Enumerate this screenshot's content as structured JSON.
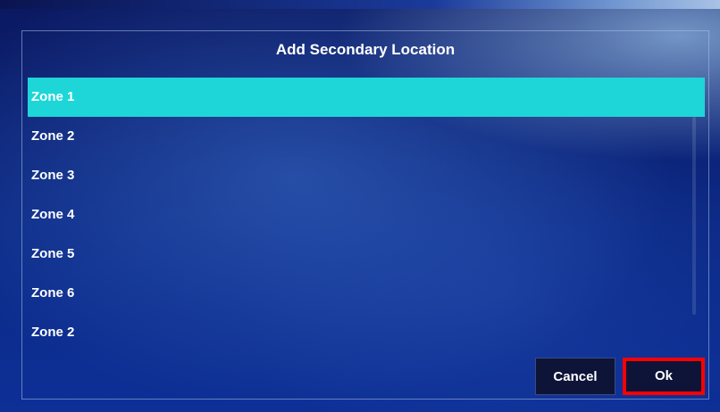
{
  "dialog": {
    "title": "Add Secondary Location",
    "items": [
      {
        "label": "Zone 1",
        "selected": true
      },
      {
        "label": "Zone 2",
        "selected": false
      },
      {
        "label": "Zone 3",
        "selected": false
      },
      {
        "label": "Zone 4",
        "selected": false
      },
      {
        "label": "Zone 5",
        "selected": false
      },
      {
        "label": "Zone 6",
        "selected": false
      },
      {
        "label": "Zone 2",
        "selected": false
      }
    ],
    "cancel_label": "Cancel",
    "ok_label": "Ok"
  },
  "colors": {
    "selection": "#1ed6d8",
    "button_bg": "#0e1438",
    "highlight_border": "#ff0000"
  }
}
